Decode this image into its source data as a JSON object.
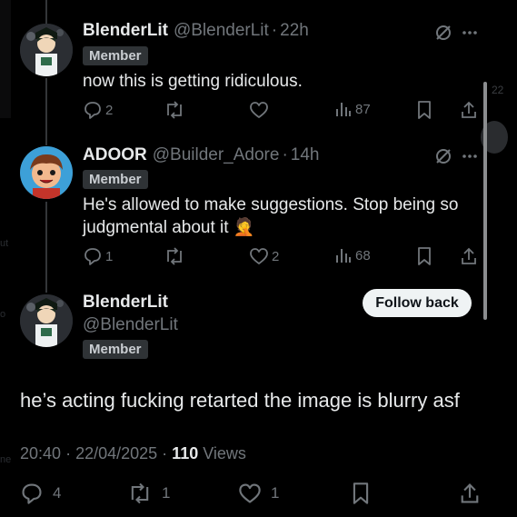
{
  "background_ghost": {
    "left_1": "ut",
    "left_2": "o",
    "left_3": "ne",
    "right_num": "22"
  },
  "tweets": [
    {
      "name": "BlenderLit",
      "handle": "@BlenderLit",
      "time": "22h",
      "badge": "Member",
      "text": "now this is getting ridiculous.",
      "replies": "2",
      "reposts": "",
      "likes": "",
      "views": "87"
    },
    {
      "name": "ADOOR",
      "handle": "@Builder_Adore",
      "time": "14h",
      "badge": "Member",
      "text_line1": "He's allowed to make suggestions. Stop being so",
      "text_line2": "judgmental about it",
      "emoji": "🤦",
      "replies": "1",
      "reposts": "",
      "likes": "2",
      "views": "68"
    }
  ],
  "main": {
    "name": "BlenderLit",
    "handle": "@BlenderLit",
    "badge": "Member",
    "follow_label": "Follow back",
    "text": "he’s acting fucking retarted the image is blurry asf",
    "time": "20:40",
    "date": "22/04/2025",
    "views_count": "110",
    "views_label": "Views",
    "replies": "4",
    "reposts": "1",
    "likes": "1"
  },
  "colors": {
    "background": "#000000",
    "text": "#e7e9ea",
    "muted": "#71767b",
    "badge_bg": "#2f3336",
    "button_bg": "#eff3f4"
  },
  "icons": [
    "grok-icon",
    "more-icon",
    "reply-icon",
    "repost-icon",
    "like-icon",
    "views-icon",
    "bookmark-icon",
    "share-icon"
  ]
}
